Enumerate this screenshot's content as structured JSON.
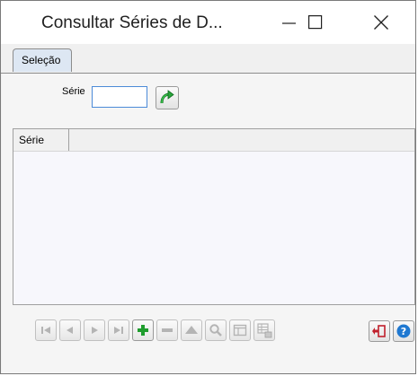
{
  "window": {
    "title": "Consultar Séries de D...",
    "controls": {
      "minimize_icon": "minimize-icon",
      "maximize_icon": "maximize-icon",
      "close_icon": "close-icon"
    }
  },
  "tabs": [
    {
      "label": "Seleção",
      "active": true
    }
  ],
  "form": {
    "serie_label": "Série",
    "serie_value": "",
    "go_icon": "green-arrow-icon"
  },
  "grid": {
    "columns": [
      "Série"
    ],
    "rows": []
  },
  "navigator": {
    "buttons": [
      {
        "name": "first-record",
        "icon": "first-icon",
        "enabled": false
      },
      {
        "name": "prior-record",
        "icon": "prior-icon",
        "enabled": false
      },
      {
        "name": "next-record",
        "icon": "next-icon",
        "enabled": false
      },
      {
        "name": "last-record",
        "icon": "last-icon",
        "enabled": false
      },
      {
        "name": "insert-record",
        "icon": "plus-icon",
        "enabled": true
      },
      {
        "name": "delete-record",
        "icon": "minus-icon",
        "enabled": false
      },
      {
        "name": "edit-record",
        "icon": "up-triangle-icon",
        "enabled": false
      },
      {
        "name": "search-record",
        "icon": "magnifier-icon",
        "enabled": false
      },
      {
        "name": "view-record",
        "icon": "form-icon",
        "enabled": false
      },
      {
        "name": "grid-export",
        "icon": "grid-export-icon",
        "enabled": false
      }
    ]
  },
  "actions": {
    "exit_icon": "exit-icon",
    "help_icon": "help-icon"
  },
  "colors": {
    "tab_bg": "#dde7f3",
    "input_border": "#4c8bd8",
    "plus_green": "#1f9d2e",
    "exit_red": "#c0202c",
    "help_blue": "#1f78d1"
  }
}
